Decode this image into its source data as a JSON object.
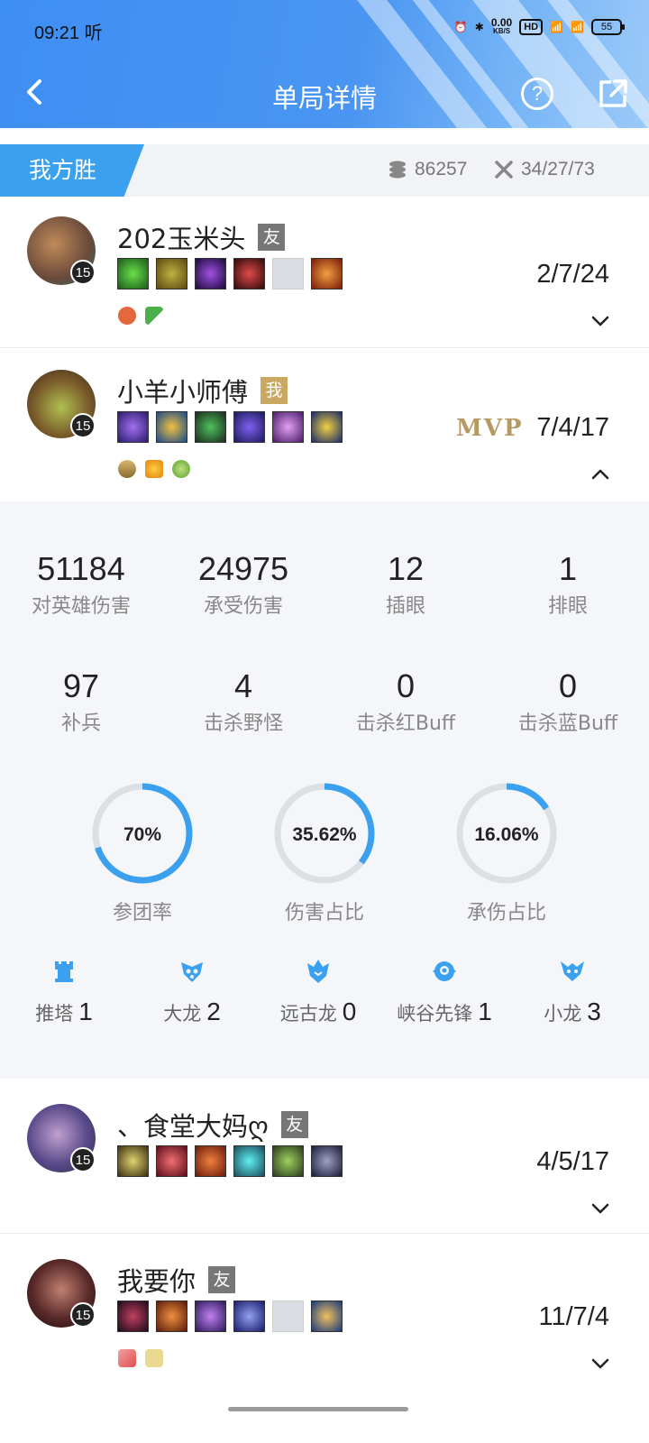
{
  "status_bar": {
    "time": "09:21",
    "carrier_icon": "听",
    "net_speed_top": "0.00",
    "net_speed_unit": "KB/S",
    "hd": "HD",
    "battery": "55"
  },
  "header": {
    "title": "单局详情"
  },
  "summary": {
    "result": "我方胜",
    "gold": "86257",
    "kda_total": "34/27/73"
  },
  "players": [
    {
      "name": "202玉米头",
      "tag": "友",
      "level": "15",
      "kda": "2/7/24",
      "avatar_color": "#6a4a3a",
      "items": [
        "#2c7a2c",
        "#8a7a20",
        "#4a2a6a",
        "#8a1a1a",
        "empty",
        "#b0501a"
      ],
      "spells": [
        "#e0603a",
        "#3aa04a"
      ]
    },
    {
      "name": "小羊小师傅",
      "tag": "我",
      "level": "15",
      "kda": "7/4/17",
      "mvp": "MVP",
      "avatar_color": "#7a5a2a",
      "items": [
        "#5a3aa0",
        "#2a6aa0",
        "#2a6a3a",
        "#4a3aa0",
        "#7a3a9a",
        "#2a3a8a"
      ],
      "spells": [
        "#c9a862",
        "#e0b020",
        "#6ab040"
      ]
    },
    {
      "name": "、食堂大妈ღ",
      "tag": "友",
      "level": "15",
      "kda": "4/5/17",
      "avatar_color": "#4a4a7a",
      "items": [
        "#7a6a20",
        "#9a2a2a",
        "#b03a1a",
        "#2a8a9a",
        "#4a6a2a",
        "#3a3a5a"
      ],
      "spells": []
    },
    {
      "name": "我要你",
      "tag": "友",
      "level": "15",
      "kda": "11/7/4",
      "avatar_color": "#5a2a2a",
      "items": [
        "#3a1a2a",
        "#8a3a1a",
        "#5a2a8a",
        "#3a3a9a",
        "empty",
        "#2a6a9a"
      ],
      "spells": [
        "#e06a6a",
        "#d0c070"
      ]
    }
  ],
  "details": {
    "stats": [
      {
        "value": "51184",
        "label": "对英雄伤害"
      },
      {
        "value": "24975",
        "label": "承受伤害"
      },
      {
        "value": "12",
        "label": "插眼"
      },
      {
        "value": "1",
        "label": "排眼"
      },
      {
        "value": "97",
        "label": "补兵"
      },
      {
        "value": "4",
        "label": "击杀野怪"
      },
      {
        "value": "0",
        "label": "击杀红Buff"
      },
      {
        "value": "0",
        "label": "击杀蓝Buff"
      }
    ],
    "rings": [
      {
        "label": "参团率",
        "text": "70%",
        "value": 0.7
      },
      {
        "label": "伤害占比",
        "text": "35.62%",
        "value": 0.3562
      },
      {
        "label": "承伤占比",
        "text": "16.06%",
        "value": 0.1606
      }
    ],
    "objectives": [
      {
        "label": "推塔",
        "count": "1",
        "icon": "tower-icon"
      },
      {
        "label": "大龙",
        "count": "2",
        "icon": "baron-icon"
      },
      {
        "label": "远古龙",
        "count": "0",
        "icon": "elder-dragon-icon"
      },
      {
        "label": "峡谷先锋",
        "count": "1",
        "icon": "rift-herald-icon"
      },
      {
        "label": "小龙",
        "count": "3",
        "icon": "dragon-icon"
      }
    ]
  },
  "colors": {
    "accent": "#3ba1ef",
    "ring_bg": "#dcdfe3",
    "mvp": "#b59a63"
  }
}
